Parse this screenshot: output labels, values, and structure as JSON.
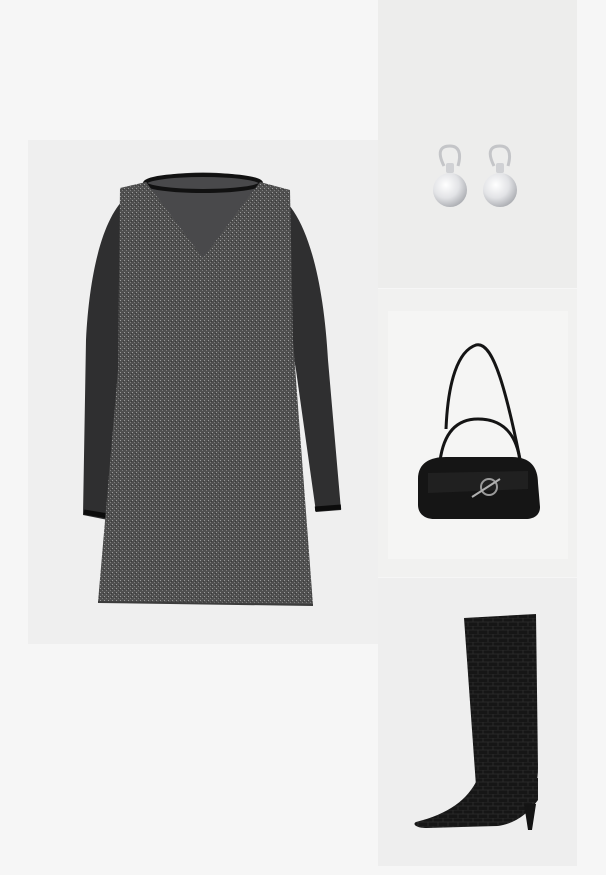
{
  "outfit": {
    "items": [
      {
        "key": "dress",
        "icon": "dress-icon",
        "colors": {
          "body": "#5a5a5a",
          "mesh": "#1d1d1f",
          "trim": "#111111"
        }
      },
      {
        "key": "earrings",
        "icon": "pearl-earrings-icon",
        "colors": {
          "pearl": "#e8e8ea",
          "metal": "#c9cacc"
        }
      },
      {
        "key": "bag",
        "icon": "handbag-icon",
        "colors": {
          "leather": "#141414",
          "hardware": "#9a9a9a"
        }
      },
      {
        "key": "boots",
        "icon": "boot-icon",
        "colors": {
          "leather": "#151515"
        }
      }
    ]
  },
  "colors": {
    "page_background": "#f6f6f6",
    "tile_background": "#efefef"
  }
}
